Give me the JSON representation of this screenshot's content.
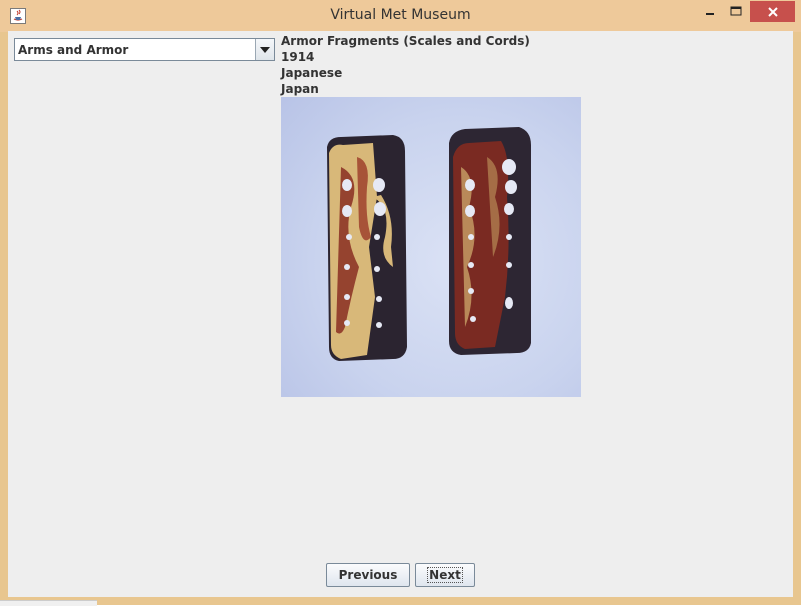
{
  "window": {
    "title": "Virtual Met Museum"
  },
  "department_select": {
    "selected": "Arms and Armor"
  },
  "artwork": {
    "title": "Armor Fragments (Scales and Cords)",
    "date": "1914",
    "culture": "Japanese",
    "country": "Japan",
    "image_icon": "artwork-image"
  },
  "navigation": {
    "previous_label": "Previous",
    "next_label": "Next"
  },
  "colors": {
    "titlebar": "#eec99a",
    "close_button": "#c7504c",
    "client_background": "#eeeeee",
    "image_background": "#c9d3ee"
  }
}
